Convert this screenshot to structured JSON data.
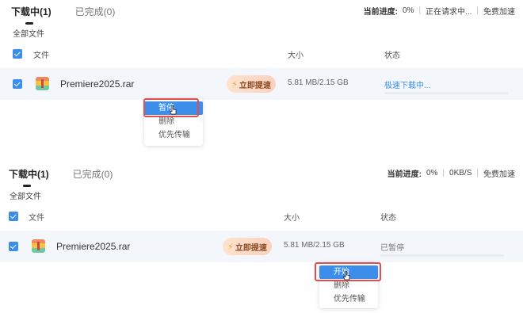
{
  "panel1": {
    "tabs": {
      "downloading": "下载中(1)",
      "completed": "已完成(0)"
    },
    "status": {
      "label": "当前进度:",
      "progress": "0%",
      "speed": "正在请求中...",
      "free": "免费加速"
    },
    "all_files": "全部文件",
    "columns": {
      "file": "文件",
      "size": "大小",
      "status": "状态"
    },
    "file": {
      "name": "Premiere2025.rar",
      "boost": "立即提速",
      "size": "5.81 MB/2.15 GB",
      "state": "极速下载中...",
      "progress_fraction": 0.0
    },
    "menu": [
      "暂停",
      "删除",
      "优先传输"
    ]
  },
  "panel2": {
    "tabs": {
      "downloading": "下载中(1)",
      "completed": "已完成(0)"
    },
    "status": {
      "label": "当前进度:",
      "progress": "0%",
      "speed": "0KB/S",
      "free": "免费加速"
    },
    "all_files": "全部文件",
    "columns": {
      "file": "文件",
      "size": "大小",
      "status": "状态"
    },
    "file": {
      "name": "Premiere2025.rar",
      "boost": "立即提速",
      "size": "5.81 MB/2.15 GB",
      "state": "已暂停",
      "progress_fraction": 0.0
    },
    "menu": [
      "开始",
      "删除",
      "优先传输"
    ]
  },
  "colors": {
    "accent": "#3d8eea",
    "highlight_box": "#e84b4b",
    "row_bg": "#f3f7fc"
  }
}
